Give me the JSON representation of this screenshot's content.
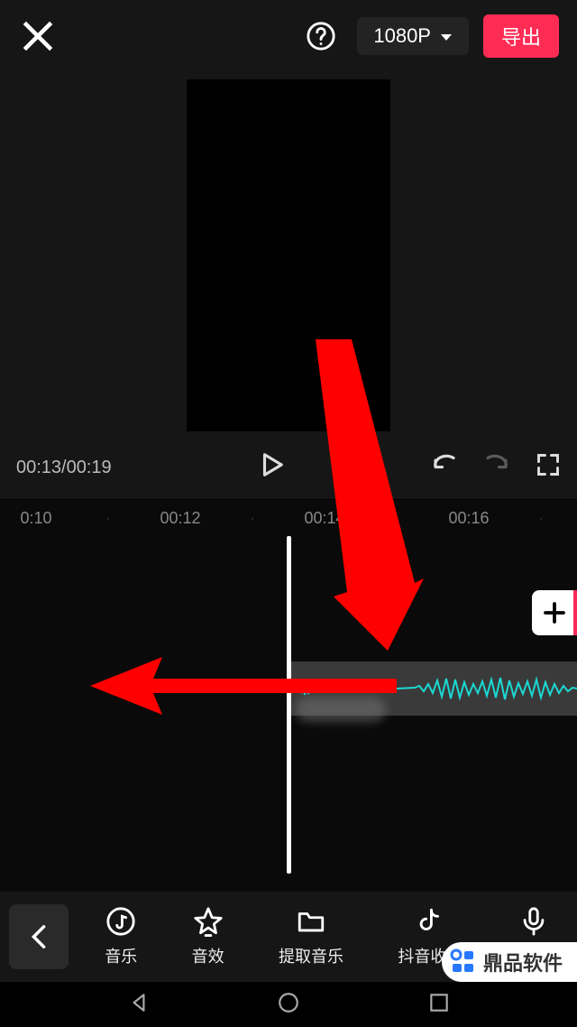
{
  "header": {
    "resolution_label": "1080P",
    "export_label": "导出"
  },
  "playback": {
    "time_display": "00:13/00:19"
  },
  "ruler": {
    "marks": [
      "0:10",
      "·",
      "00:12",
      "·",
      "00:14",
      "·",
      "00:16",
      "·"
    ]
  },
  "toolbar": {
    "music": "音乐",
    "sound_effect": "音效",
    "extract_music": "提取音乐",
    "douyin_favorites": "抖音收藏",
    "record": "录音"
  },
  "watermark": {
    "text": "鼎品软件"
  },
  "colors": {
    "accent": "#fe2c55",
    "waveform": "#1cd8d2",
    "arrow": "#ff0000"
  }
}
